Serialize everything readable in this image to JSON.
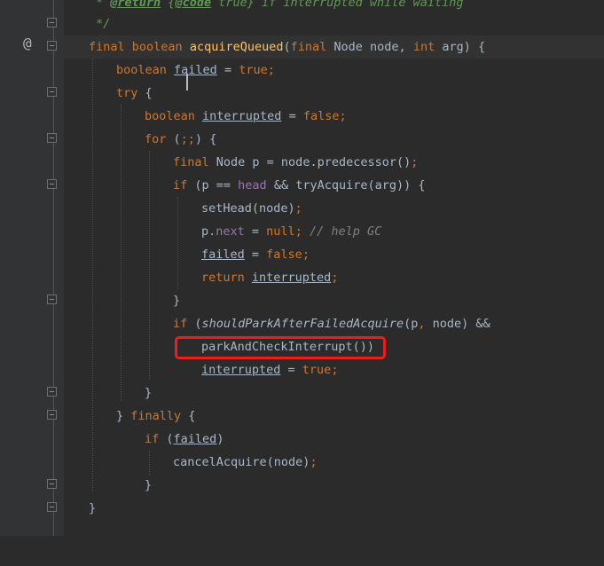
{
  "gutter": {
    "annotation_icon": "@"
  },
  "lines": {
    "doc_star": "* ",
    "doc_return_tag": "@return",
    "doc_space": " {",
    "doc_code_tag": "@code",
    "doc_rest": " true} if interrupted while waiting",
    "doc_close": "*/",
    "l1_final": "final ",
    "l1_boolean": "boolean ",
    "l1_method": "acquireQueued",
    "l1_open": "(",
    "l1_final2": "final ",
    "l1_node_type": "Node node, ",
    "l1_int": "int ",
    "l1_rest": "arg) {",
    "l2_boolean": "boolean ",
    "l2_var": "failed",
    "l2_eq": " = ",
    "l2_true": "true",
    "l2_semi": ";",
    "l3_try": "try ",
    "l3_brace": "{",
    "l4_boolean": "boolean ",
    "l4_var": "interrupted",
    "l4_eq": " = ",
    "l4_false": "false",
    "l4_semi": ";",
    "l5_for": "for ",
    "l5_paren": "(",
    "l5_semis": ";;",
    "l5_rest": ") {",
    "l6_final": "final ",
    "l6_rest": "Node p = node.predecessor()",
    "l6_semi": ";",
    "l7_if": "if ",
    "l7_a": "(p == ",
    "l7_head": "head",
    "l7_b": " && tryAcquire(arg)) {",
    "l8_call": "setHead(node)",
    "l8_semi": ";",
    "l9_p": "p.",
    "l9_next": "next",
    "l9_eq": " = ",
    "l9_null": "null",
    "l9_semi": "; ",
    "l9_comment": "// help GC",
    "l10_var": "failed",
    "l10_eq": " = ",
    "l10_false": "false",
    "l10_semi": ";",
    "l11_return": "return ",
    "l11_var": "interrupted",
    "l11_semi": ";",
    "l12_close": "}",
    "l13_if": "if ",
    "l13_paren": "(",
    "l13_method": "shouldParkAfterFailedAcquire",
    "l13_args": "(p",
    "l13_comma": ", ",
    "l13_rest": "node) &&",
    "l14_call": "parkAndCheckInterrupt())",
    "l15_var": "interrupted",
    "l15_eq": " = ",
    "l15_true": "true",
    "l15_semi": ";",
    "l16_close": "}",
    "l17_close": "} ",
    "l17_finally": "finally ",
    "l17_brace": "{",
    "l18_if": "if ",
    "l18_paren": "(",
    "l18_var": "failed",
    "l18_close": ")",
    "l19_call": "cancelAcquire(node)",
    "l19_semi": ";",
    "l20_close": "}",
    "l21_close": "}"
  }
}
